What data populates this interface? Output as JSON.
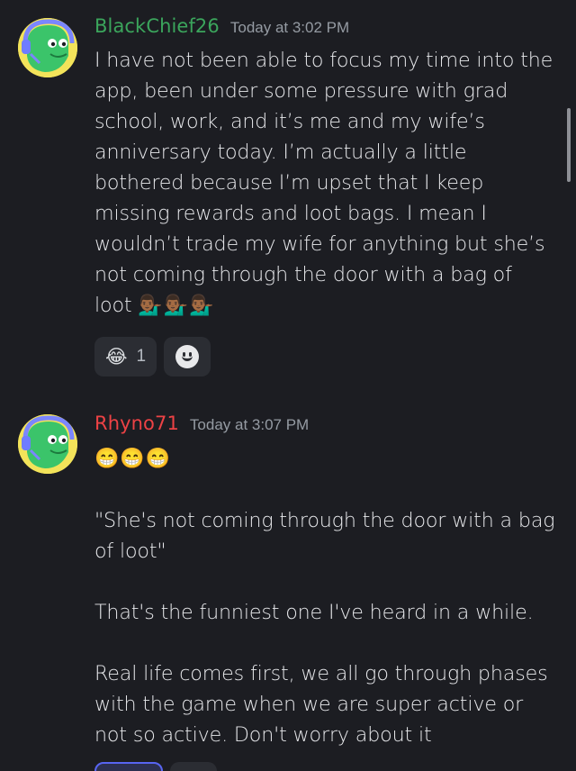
{
  "messages": [
    {
      "username": "BlackChief26",
      "username_color": "#3ba55c",
      "timestamp": "Today at 3:02 PM",
      "avatar_icon": "headset-avatar-icon",
      "lines": [
        "I have not been able to focus my time into the",
        "app, been under some pressure with grad",
        "school, work, and it’s me and my wife’s",
        "anniversary today. I’m actually a little",
        "bothered because I’m upset that I keep",
        "missing rewards and loot bags. I mean I",
        "wouldn’t trade my wife for anything but she’s",
        "not coming through the door with a bag of",
        "loot"
      ],
      "trailing_emoji": "💁🏾‍♂️💁🏾‍♂️💁🏾‍♂️",
      "reactions": [
        {
          "emoji": "😂",
          "count": "1"
        }
      ],
      "add_reaction_icon": "add-reaction-smile-icon"
    },
    {
      "username": "Rhyno71",
      "username_color": "#ed4245",
      "timestamp": "Today at 3:07 PM",
      "avatar_icon": "headset-avatar-icon",
      "emoji_line": "😁😁😁",
      "paragraphs": [
        [
          "\"She's not coming through the door with a bag",
          "of loot\""
        ],
        [
          "That's the funniest one I've heard in a while."
        ],
        [
          "Real life comes first, we all go through phases",
          "with the game when we are super active or",
          "not so active. Don't worry about it"
        ]
      ]
    }
  ],
  "colors": {
    "background": "#1c1d22",
    "reaction_bg": "#2b2d33",
    "timestamp": "#959ba3",
    "text": "#e6e7ea"
  }
}
